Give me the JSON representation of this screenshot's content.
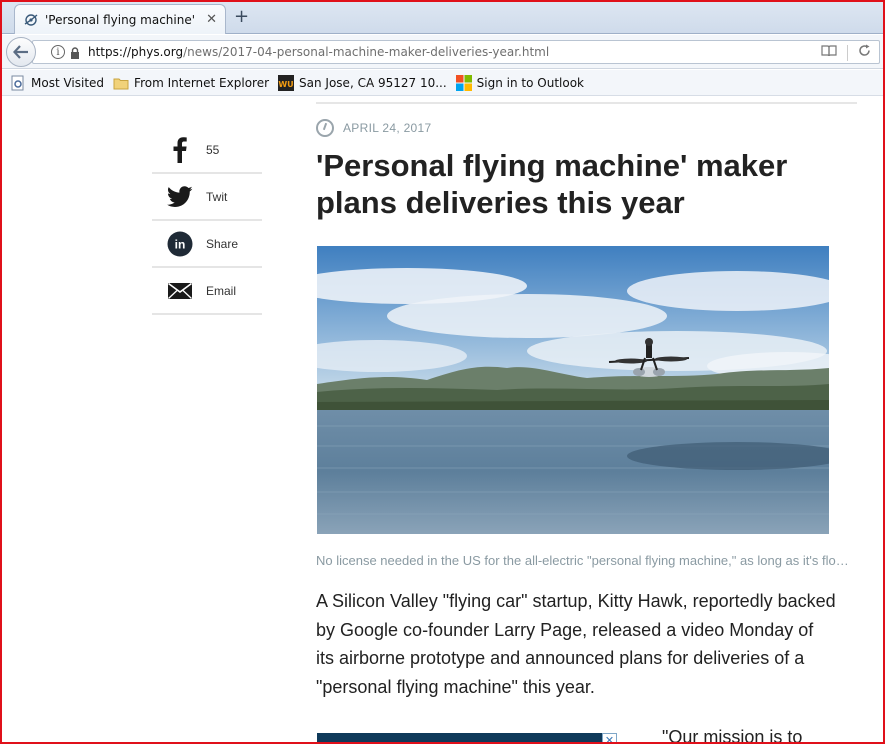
{
  "browser": {
    "tab": {
      "title": "'Personal flying machine' ...",
      "close": "✕"
    },
    "new_tab": "+",
    "url": {
      "host": "https://phys.org",
      "path": "/news/2017-04-personal-machine-maker-deliveries-year.html"
    },
    "url_actions": {
      "reader": "▭",
      "reload": "C"
    },
    "bookmarks": [
      {
        "label": "Most Visited",
        "icon": "gear-page-icon"
      },
      {
        "label": "From Internet Explorer",
        "icon": "folder-icon"
      },
      {
        "label": "San Jose, CA 95127 10...",
        "icon": "wu-icon"
      },
      {
        "label": "Sign in to Outlook",
        "icon": "windows-icon"
      }
    ]
  },
  "share": {
    "items": [
      {
        "icon": "facebook-icon",
        "label": "55"
      },
      {
        "icon": "twitter-icon",
        "label": "Twit"
      },
      {
        "icon": "linkedin-icon",
        "label": "Share"
      },
      {
        "icon": "email-icon",
        "label": "Email"
      }
    ]
  },
  "article": {
    "date": "APRIL 24, 2017",
    "headline": "'Personal flying machine' maker plans deliveries this year",
    "caption": "No license needed in the US for the all-electric \"personal flying machine,\" as long as it's flown in uncongested areas",
    "body": "A Silicon Valley \"flying car\" startup, Kitty Hawk, reportedly backed by Google co-founder Larry Page, released a video Monday of its airborne prototype and announced plans for deliveries of a \"personal flying machine\" this year.",
    "quote_start": "\"Our mission is to"
  },
  "ad": {
    "close": "✕"
  },
  "colors": {
    "frame": "#e0101a",
    "text": "#222222",
    "muted": "#8a9aa2"
  }
}
